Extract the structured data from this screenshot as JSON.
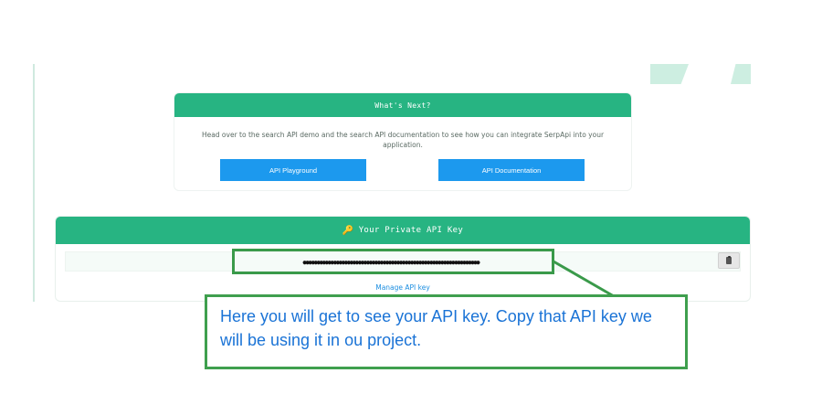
{
  "whats_next": {
    "title": "What's Next?",
    "description": "Head over to the search API demo and the search API documentation to see how you can integrate SerpApi into your application.",
    "buttons": [
      {
        "label": "API Playground"
      },
      {
        "label": "API Documentation"
      }
    ]
  },
  "api_key_panel": {
    "title": "Your Private API Key",
    "title_icon": "key-icon",
    "masked_key": "●●●●●●●●●●●●●●●●●●●●●●●●●●●●●●●●●●●●●●●●●●●●●●●●●●●●●●●●●●●●●●●●",
    "copy_icon": "clipboard-icon",
    "manage_link": "Manage API key"
  },
  "callout": {
    "text": "Here you will get to see your API key. Copy that API key we will be using it in ou project."
  },
  "colors": {
    "header_green": "#27b482",
    "button_blue": "#1c99ee",
    "callout_border": "#3f9f4e",
    "callout_text": "#1a73d6"
  }
}
